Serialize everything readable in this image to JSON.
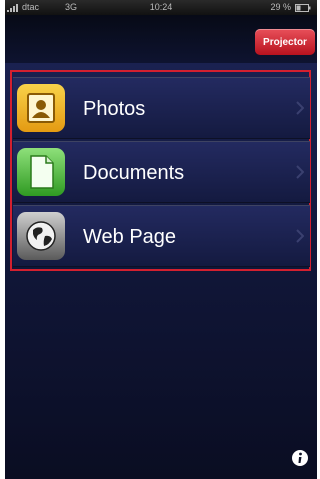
{
  "status_bar": {
    "carrier": "dtac",
    "network": "3G",
    "time": "10:24",
    "battery": "29 %"
  },
  "nav_bar": {
    "projector_label": "Projector"
  },
  "menu": {
    "items": [
      {
        "label": "Photos",
        "icon": "photos-icon"
      },
      {
        "label": "Documents",
        "icon": "document-icon"
      },
      {
        "label": "Web Page",
        "icon": "globe-icon"
      }
    ]
  },
  "footer": {
    "info_icon": "info-icon"
  },
  "colors": {
    "background": "#0c1024",
    "projector_button": "#d3202f",
    "highlight_frame": "#d3202f"
  }
}
